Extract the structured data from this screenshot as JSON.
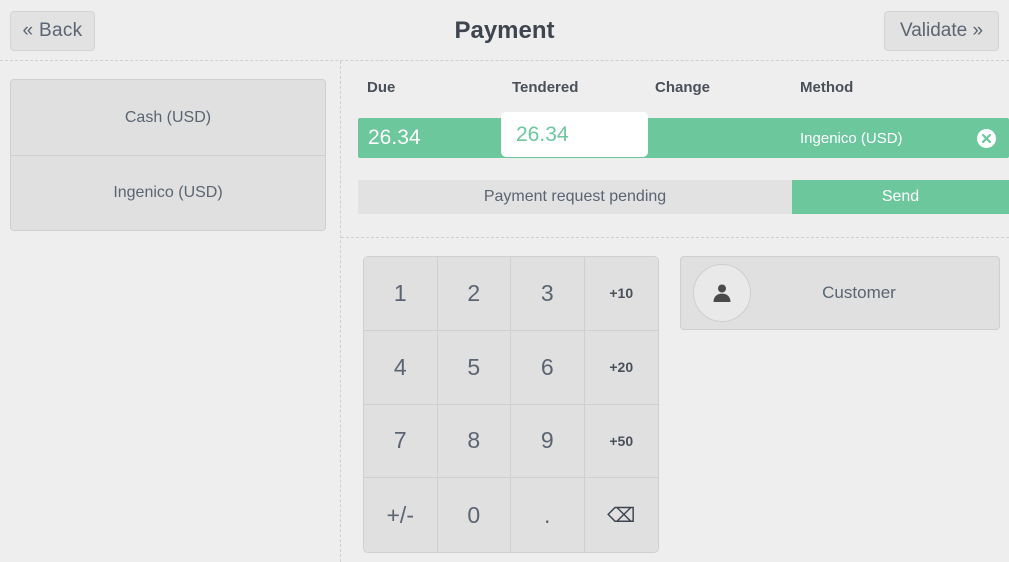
{
  "header": {
    "title": "Payment",
    "back_label": "« Back",
    "validate_label": "Validate »"
  },
  "payment_methods": {
    "items": [
      {
        "label": "Cash (USD)"
      },
      {
        "label": "Ingenico (USD)"
      }
    ]
  },
  "payment_lines": {
    "columns": {
      "due": "Due",
      "tendered": "Tendered",
      "change": "Change",
      "method": "Method"
    },
    "row": {
      "due": "26.34",
      "tendered_value": "26.34",
      "tendered_placeholder": "",
      "change": "",
      "method": "Ingenico (USD)",
      "delete_icon": "close-circle-icon"
    },
    "status_text": "Payment request pending",
    "send_label": "Send"
  },
  "numpad": {
    "keys": [
      {
        "label": "1",
        "name": "numpad-key-1",
        "style": "digit"
      },
      {
        "label": "2",
        "name": "numpad-key-2",
        "style": "digit"
      },
      {
        "label": "3",
        "name": "numpad-key-3",
        "style": "digit"
      },
      {
        "label": "+10",
        "name": "numpad-key-plus10",
        "style": "small"
      },
      {
        "label": "4",
        "name": "numpad-key-4",
        "style": "digit"
      },
      {
        "label": "5",
        "name": "numpad-key-5",
        "style": "digit"
      },
      {
        "label": "6",
        "name": "numpad-key-6",
        "style": "digit"
      },
      {
        "label": "+20",
        "name": "numpad-key-plus20",
        "style": "small"
      },
      {
        "label": "7",
        "name": "numpad-key-7",
        "style": "digit"
      },
      {
        "label": "8",
        "name": "numpad-key-8",
        "style": "digit"
      },
      {
        "label": "9",
        "name": "numpad-key-9",
        "style": "digit"
      },
      {
        "label": "+50",
        "name": "numpad-key-plus50",
        "style": "small"
      },
      {
        "label": "+/-",
        "name": "numpad-key-sign",
        "style": "digit"
      },
      {
        "label": "0",
        "name": "numpad-key-0",
        "style": "digit"
      },
      {
        "label": ".",
        "name": "numpad-key-decimal",
        "style": "digit"
      },
      {
        "label": "⌫",
        "name": "numpad-key-backspace",
        "style": "icon"
      }
    ]
  },
  "customer": {
    "label": "Customer",
    "avatar_icon": "person-icon"
  },
  "colors": {
    "accent_green": "#6cc79d",
    "page_background": "#efeeee",
    "button_grey": "#e0e0e0",
    "border_grey": "#cfcfcf",
    "text_grey": "#5b6471"
  }
}
